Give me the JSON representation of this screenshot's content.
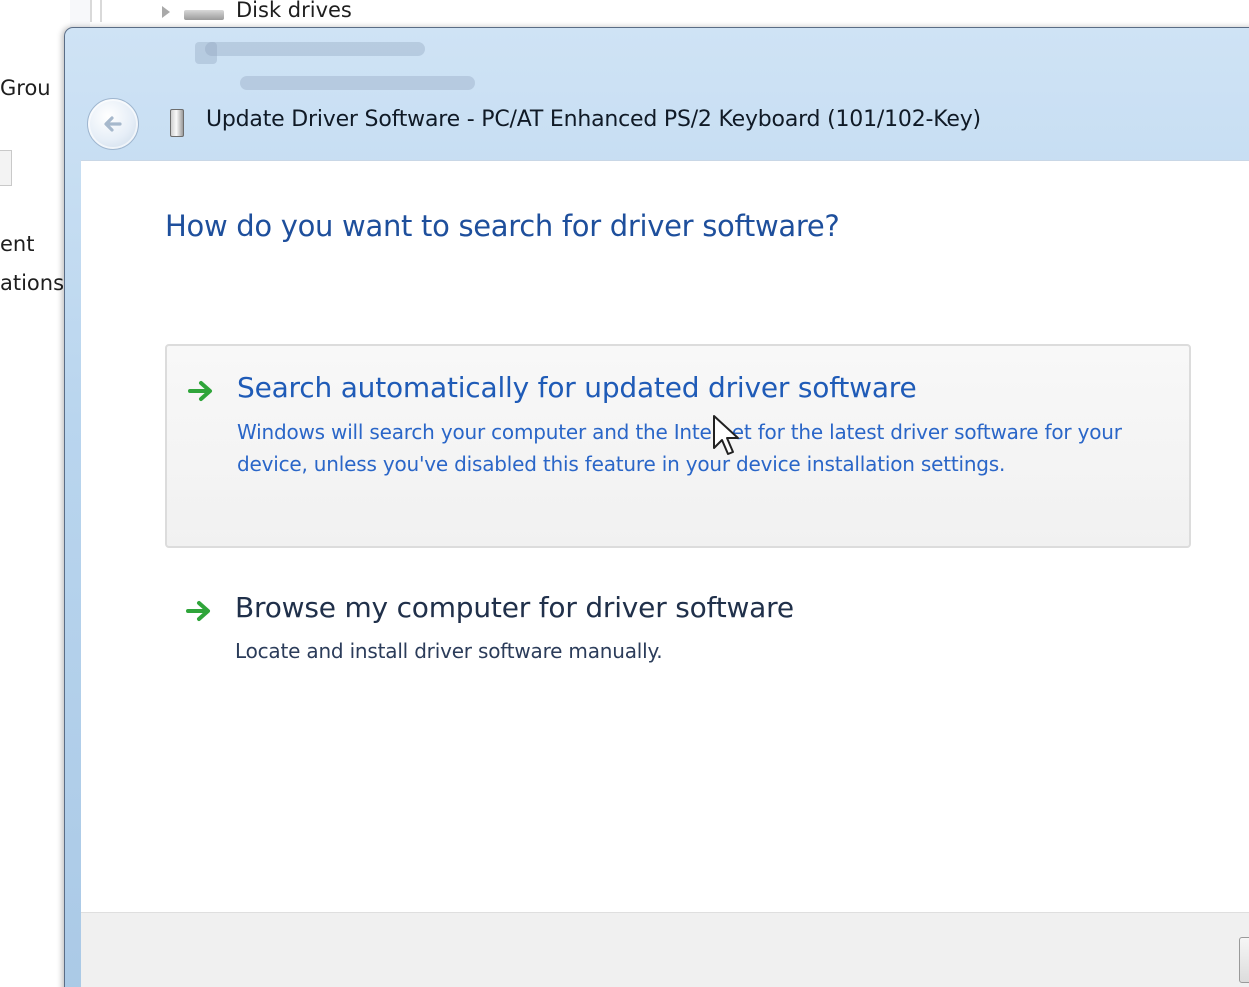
{
  "background": {
    "left_texts": [
      "Grou",
      "ent",
      "ations"
    ],
    "tree_item": "Disk drives"
  },
  "window": {
    "title": "Update Driver Software - PC/AT Enhanced PS/2 Keyboard (101/102-Key)",
    "back_icon": "back-arrow-icon",
    "device_icon": "keyboard-device-icon"
  },
  "content": {
    "heading": "How do you want to search for driver software?",
    "options": [
      {
        "title": "Search automatically for updated driver software",
        "description": "Windows will search your computer and the Internet for the latest driver software for your device, unless you've disabled this feature in your device installation settings.",
        "icon": "green-arrow-icon",
        "highlighted": true
      },
      {
        "title": "Browse my computer for driver software",
        "description": "Locate and install driver software manually.",
        "icon": "green-arrow-icon",
        "highlighted": false
      }
    ]
  },
  "colors": {
    "heading": "#1e4f9c",
    "highlighted_option_text": "#1f5bb7",
    "option_text": "#20304a",
    "arrow_green": "#2fa53a",
    "title_bar": "#b9d5ee"
  }
}
